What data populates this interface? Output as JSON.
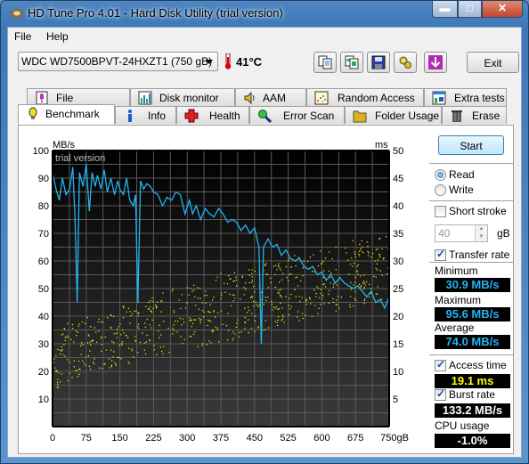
{
  "window": {
    "title": "HD Tune Pro 4.01 - Hard Disk Utility (trial version)",
    "controls": {
      "minimize": "minimize",
      "maximize": "maximize",
      "close": "close"
    }
  },
  "menu": [
    {
      "label": "File"
    },
    {
      "label": "Help"
    }
  ],
  "toolbar": {
    "drive": "WDC WD7500BPVT-24HXZT1 (750 gB)",
    "temperature": "41°C",
    "buttons": [
      {
        "name": "copy-text-icon"
      },
      {
        "name": "copy-screenshot-icon"
      },
      {
        "name": "save-icon"
      },
      {
        "name": "options-icon"
      },
      {
        "name": "download-icon"
      }
    ],
    "exit_label": "Exit"
  },
  "tabs_top": [
    {
      "label": "File Benchmark",
      "icon": "file-benchmark-icon"
    },
    {
      "label": "Disk monitor",
      "icon": "disk-monitor-icon"
    },
    {
      "label": "AAM",
      "icon": "speaker-icon"
    },
    {
      "label": "Random Access",
      "icon": "random-access-icon"
    },
    {
      "label": "Extra tests",
      "icon": "extra-tests-icon"
    }
  ],
  "tabs_bottom": [
    {
      "label": "Benchmark",
      "icon": "lightbulb-icon",
      "active": true
    },
    {
      "label": "Info",
      "icon": "info-icon"
    },
    {
      "label": "Health",
      "icon": "health-cross-icon"
    },
    {
      "label": "Error Scan",
      "icon": "magnifier-icon"
    },
    {
      "label": "Folder Usage",
      "icon": "folder-icon"
    },
    {
      "label": "Erase",
      "icon": "trash-icon"
    }
  ],
  "side": {
    "start_label": "Start",
    "read_label": "Read",
    "write_label": "Write",
    "mode": "Read",
    "short_stroke_label": "Short stroke",
    "short_stroke_checked": false,
    "short_stroke_value": "40",
    "short_stroke_unit": "gB",
    "transfer_rate_label": "Transfer rate",
    "transfer_rate_checked": true,
    "minimum_label": "Minimum",
    "minimum_value": "30.9 MB/s",
    "maximum_label": "Maximum",
    "maximum_value": "95.6 MB/s",
    "average_label": "Average",
    "average_value": "74.0 MB/s",
    "access_time_label": "Access time",
    "access_time_checked": true,
    "access_time_value": "19.1 ms",
    "burst_rate_label": "Burst rate",
    "burst_rate_checked": true,
    "burst_rate_value": "133.2 MB/s",
    "cpu_label": "CPU usage",
    "cpu_value": "-1.0%",
    "colors": {
      "transfer": "#22b4f0",
      "access": "#ffff00",
      "burst": "#ffffff"
    }
  },
  "chart_data": {
    "type": "line",
    "watermark": "trial version",
    "ylabel_left": "MB/s",
    "ylabel_right": "ms",
    "x_unit": "gB",
    "xlim": [
      0,
      750
    ],
    "ylim_left": [
      0,
      100
    ],
    "ylim_right": [
      0,
      50
    ],
    "x_ticks": [
      "0",
      "75",
      "150",
      "225",
      "300",
      "375",
      "450",
      "525",
      "600",
      "675",
      "750gB"
    ],
    "y_ticks_left": [
      "10",
      "20",
      "30",
      "40",
      "50",
      "60",
      "70",
      "80",
      "90",
      "100"
    ],
    "y_ticks_right": [
      "5",
      "10",
      "15",
      "20",
      "25",
      "30",
      "35",
      "40",
      "45",
      "50"
    ],
    "grid": true,
    "series": [
      {
        "name": "Transfer rate (MB/s)",
        "color": "#22b4f0",
        "x": [
          0,
          8,
          15,
          22,
          30,
          38,
          45,
          50,
          55,
          60,
          68,
          75,
          82,
          88,
          95,
          100,
          108,
          115,
          122,
          130,
          138,
          145,
          150,
          158,
          165,
          172,
          180,
          185,
          190,
          196,
          203,
          210,
          218,
          225,
          235,
          245,
          255,
          265,
          275,
          285,
          295,
          305,
          312,
          320,
          330,
          340,
          350,
          360,
          370,
          380,
          390,
          400,
          410,
          420,
          430,
          440,
          450,
          460,
          465,
          470,
          480,
          490,
          500,
          510,
          520,
          530,
          540,
          550,
          560,
          570,
          580,
          590,
          600,
          610,
          620,
          630,
          640,
          650,
          660,
          670,
          680,
          690,
          700,
          710,
          720,
          730,
          740,
          750
        ],
        "values": [
          92,
          86,
          82,
          90,
          84,
          86,
          94,
          76,
          45,
          92,
          87,
          95,
          78,
          92,
          87,
          91,
          86,
          93,
          85,
          90,
          84,
          89,
          86,
          84,
          90,
          82,
          80,
          84,
          45,
          89,
          86,
          88,
          87,
          85,
          84,
          80,
          83,
          82,
          85,
          84,
          77,
          82,
          77,
          80,
          75,
          79,
          77,
          76,
          79,
          77,
          74,
          75,
          74,
          71,
          73,
          70,
          72,
          65,
          30,
          65,
          68,
          65,
          66,
          62,
          64,
          61,
          60,
          61,
          58,
          57,
          58,
          55,
          56,
          53,
          55,
          52,
          54,
          52,
          51,
          50,
          51,
          49,
          47,
          49,
          45,
          46,
          43,
          47
        ]
      },
      {
        "name": "Access time (ms)",
        "color": "#ffff00",
        "type": "scatter",
        "range_by_x": [
          {
            "x": 0,
            "min": 6,
            "max": 18
          },
          {
            "x": 75,
            "min": 10,
            "max": 20
          },
          {
            "x": 150,
            "min": 11,
            "max": 22
          },
          {
            "x": 225,
            "min": 13,
            "max": 24
          },
          {
            "x": 300,
            "min": 14,
            "max": 26
          },
          {
            "x": 375,
            "min": 15,
            "max": 28
          },
          {
            "x": 450,
            "min": 17,
            "max": 29
          },
          {
            "x": 525,
            "min": 19,
            "max": 31
          },
          {
            "x": 600,
            "min": 20,
            "max": 32
          },
          {
            "x": 675,
            "min": 22,
            "max": 34
          },
          {
            "x": 750,
            "min": 23,
            "max": 35
          }
        ]
      }
    ]
  }
}
